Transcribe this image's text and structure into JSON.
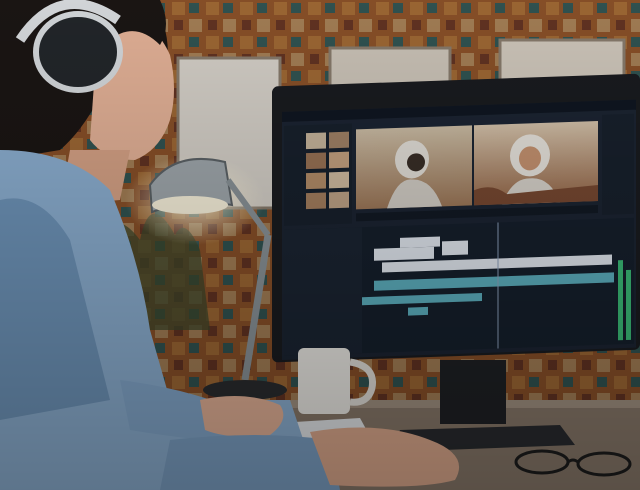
{
  "scene": {
    "subject": "woman-with-headphones-editing-video",
    "colors": {
      "wall_orange": "#c8783a",
      "wall_teal": "#2f6f74",
      "wall_cream": "#e7d2ad",
      "shirt_blue": "#8fb3d6",
      "shirt_shadow": "#5e86ad",
      "skin": "#e8b59a",
      "hair": "#1b1614",
      "monitor_frame": "#1a1c20",
      "ui_panel": "#1c2533",
      "ui_timeline_bg": "#16202d",
      "clip_white": "#e8eef6",
      "clip_teal": "#5fb4c4",
      "lamp_metal": "#9aa3a8",
      "desk": "#8b7b6c",
      "mug": "#f1efea"
    }
  }
}
